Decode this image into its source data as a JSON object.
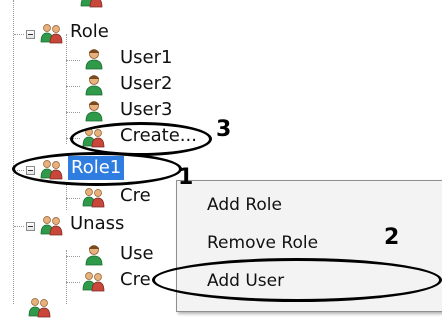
{
  "tree": {
    "role": "Role",
    "user1": "User1",
    "user2": "User2",
    "user3": "User3",
    "create_user": "Create...",
    "role1": "Role1",
    "create_partial": "Cre",
    "unassigned_partial": "Unass",
    "user_partial": "Use",
    "create_partial2": "Cre"
  },
  "context_menu": {
    "items": [
      "Add Role",
      "Remove Role",
      "Add User"
    ]
  },
  "annotations": {
    "numbers": [
      "3",
      "1",
      "2"
    ]
  },
  "colors": {
    "selection": "#2f7de1"
  },
  "icons": [
    "role-group-icon",
    "user-icon",
    "create-user-icon"
  ]
}
